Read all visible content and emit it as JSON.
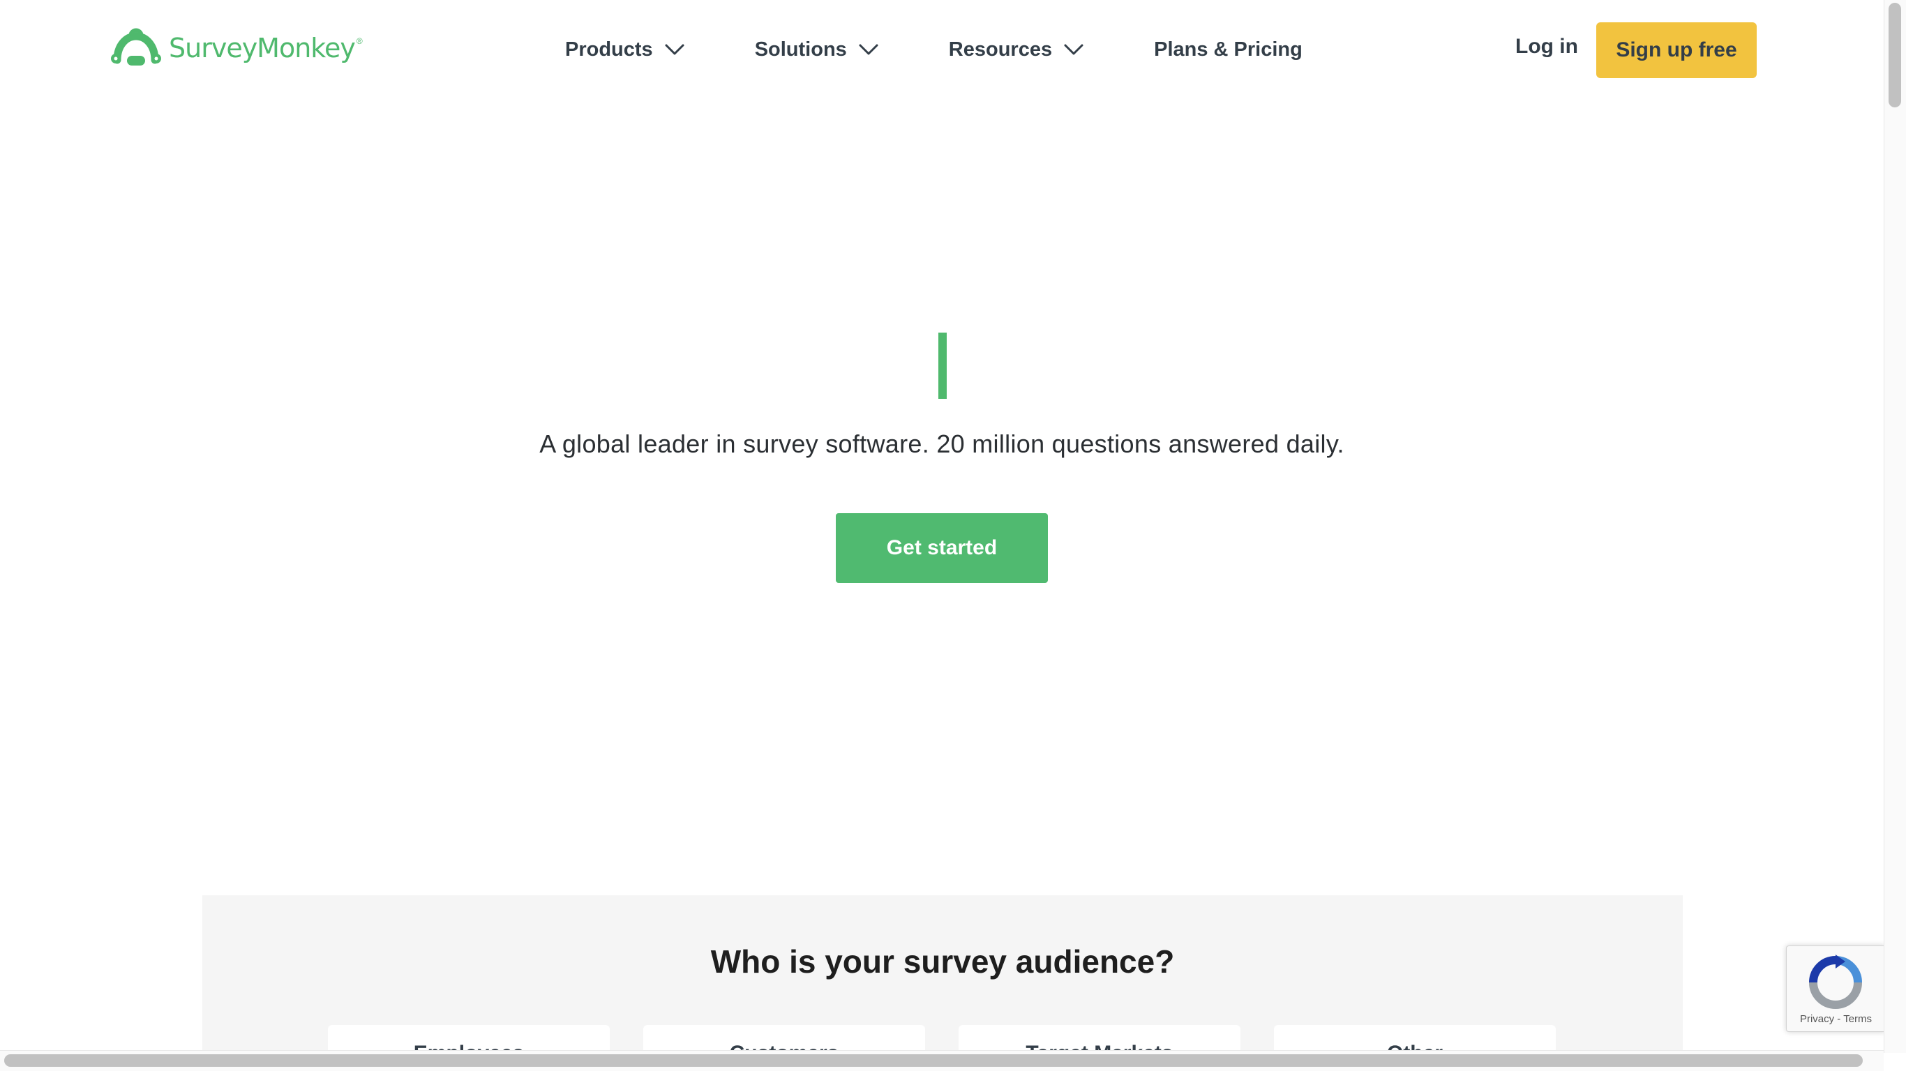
{
  "header": {
    "logo_text": "SurveyMonkey",
    "logo_mark": "®",
    "nav": [
      {
        "label": "Products",
        "icon": "chevron-down-icon"
      },
      {
        "label": "Solutions",
        "icon": "chevron-down-icon"
      },
      {
        "label": "Resources",
        "icon": "chevron-down-icon"
      },
      {
        "label": "Plans & Pricing"
      }
    ],
    "login_label": "Log in",
    "signup_label": "Sign up free"
  },
  "hero": {
    "tagline": "A global leader in survey software. 20 million questions answered daily.",
    "cta_label": "Get started"
  },
  "audience": {
    "title": "Who is your survey audience?",
    "options": [
      "Employees",
      "Customers",
      "Target Markets",
      "Other"
    ]
  },
  "recaptcha": {
    "privacy_label": "Privacy",
    "separator": " - ",
    "terms_label": "Terms"
  },
  "colors": {
    "brand_green": "#4fb96d",
    "cta_green": "#50ba70",
    "signup_yellow": "#f2c33f",
    "nav_text": "#333e48",
    "section_gray": "#f5f5f5"
  }
}
